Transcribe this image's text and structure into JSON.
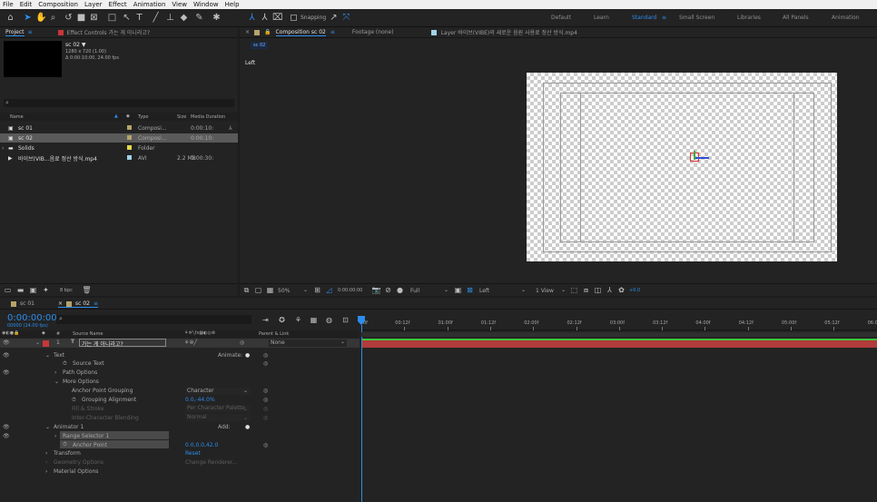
{
  "menu": [
    "File",
    "Edit",
    "Composition",
    "Layer",
    "Effect",
    "Animation",
    "View",
    "Window",
    "Help"
  ],
  "toolbar": {
    "snapping_label": "Snapping",
    "workspaces": [
      "Default",
      "Learn",
      "Standard",
      "Small Screen",
      "Libraries",
      "All Panels",
      "Animation"
    ],
    "active_workspace": "Standard"
  },
  "project_panel": {
    "tab_project": "Project",
    "tab_effect_controls": "Effect Controls 가는 게 아니라고?",
    "selected_name": "sc 02 ▼",
    "selected_info1": "1280 x 720 (1.00)",
    "selected_info2": "Δ 0:00:10:00, 24.00 fps",
    "search_icon": "⌕",
    "columns": [
      "Name",
      "Type",
      "Size",
      "Media Duration"
    ],
    "items": [
      {
        "name": "sc 01",
        "type": "Composi...",
        "size": "",
        "duration": "0:00:10:",
        "color": "#b5a46a",
        "kind": "comp"
      },
      {
        "name": "sc 02",
        "type": "Composi...",
        "size": "",
        "duration": "0:00:10:",
        "color": "#b5a46a",
        "kind": "comp",
        "selected": true
      },
      {
        "name": "Solids",
        "type": "Folder",
        "size": "",
        "duration": "",
        "color": "#e4d94e",
        "kind": "folder"
      },
      {
        "name": "바이브(VIB...음료 정산 방식.mp4",
        "type": "AVI",
        "size": "2.2 MB",
        "duration": "0:00:30:",
        "color": "#a1d2e6",
        "kind": "footage"
      }
    ],
    "bpc_label": "8 bpc"
  },
  "viewer": {
    "tab_comp": "Composition sc 02",
    "tab_footage": "Footage (none)",
    "tab_layer": "Layer 바이브(VIBE)의 새로운 음원 사용료 정산 방식.mp4",
    "comp_chip": "sc 02",
    "view_label": "Left",
    "zoom": "50%",
    "timecode": "0:00:00:00",
    "resolution": "Full",
    "view_dropdown": "Left",
    "views_count": "1 View",
    "exposure": "+0.0"
  },
  "timeline": {
    "tabs": [
      {
        "label": "sc 01",
        "color": "#b5a46a"
      },
      {
        "label": "sc 02",
        "color": "#b5a46a",
        "active": true
      }
    ],
    "timecode": "0:00:00:00",
    "fps_info": "00000 (24.00 fps)",
    "col_source_name": "Source Name",
    "col_parent": "Parent & Link",
    "ruler": [
      "0f",
      "00:12f",
      "01:00f",
      "01:12f",
      "02:00f",
      "02:12f",
      "03:00f",
      "03:12f",
      "04:00f",
      "04:12f",
      "05:00f",
      "05:12f",
      "06:0"
    ],
    "layer": {
      "number": "1",
      "type": "T",
      "name": "가는 게 아니라고?",
      "parent": "None"
    },
    "rows": [
      {
        "indent": 1,
        "arrow": "⌄",
        "label": "Text",
        "right": "Animate:",
        "right_icon": "●",
        "dim": false
      },
      {
        "indent": 2,
        "arrow": "",
        "stopwatch": true,
        "label": "Source Text",
        "value": "",
        "dim": false
      },
      {
        "indent": 2,
        "arrow": "›",
        "label": "Path Options",
        "dim": false
      },
      {
        "indent": 2,
        "arrow": "⌄",
        "label": "More Options",
        "dim": false
      },
      {
        "indent": 3,
        "arrow": "",
        "label": "Anchor Point Grouping",
        "value": "Character",
        "dropdown": true,
        "dim": false
      },
      {
        "indent": 3,
        "arrow": "",
        "stopwatch": true,
        "label": "Grouping Alignment",
        "value": "0.0,-44.0%",
        "blue": true,
        "dim": false
      },
      {
        "indent": 3,
        "arrow": "",
        "label": "Fill & Stroke",
        "value": "Per Character Palette",
        "dropdown": true,
        "dim": true
      },
      {
        "indent": 3,
        "arrow": "",
        "label": "Inter-Character Blending",
        "value": "Normal",
        "dropdown": true,
        "dim": true
      },
      {
        "indent": 1,
        "arrow": "⌄",
        "label": "Animator 1",
        "right": "Add:",
        "right_icon": "●",
        "dim": false
      },
      {
        "indent": 2,
        "arrow": "›",
        "label": "Range Selector 1",
        "dim": false,
        "highlight": true
      },
      {
        "indent": 2,
        "arrow": "",
        "stopwatch": true,
        "label": "Anchor Point",
        "value": "0.0,0.0,42.0",
        "blue": true,
        "dim": false,
        "highlight": true
      },
      {
        "indent": 1,
        "arrow": "›",
        "label": "Transform",
        "value": "Reset",
        "blue": true,
        "dim": false
      },
      {
        "indent": 1,
        "arrow": "›",
        "label": "Geometry Options",
        "value": "Change Renderer...",
        "blue": true,
        "dim": true
      },
      {
        "indent": 1,
        "arrow": "›",
        "label": "Material Options",
        "dim": false
      }
    ]
  }
}
